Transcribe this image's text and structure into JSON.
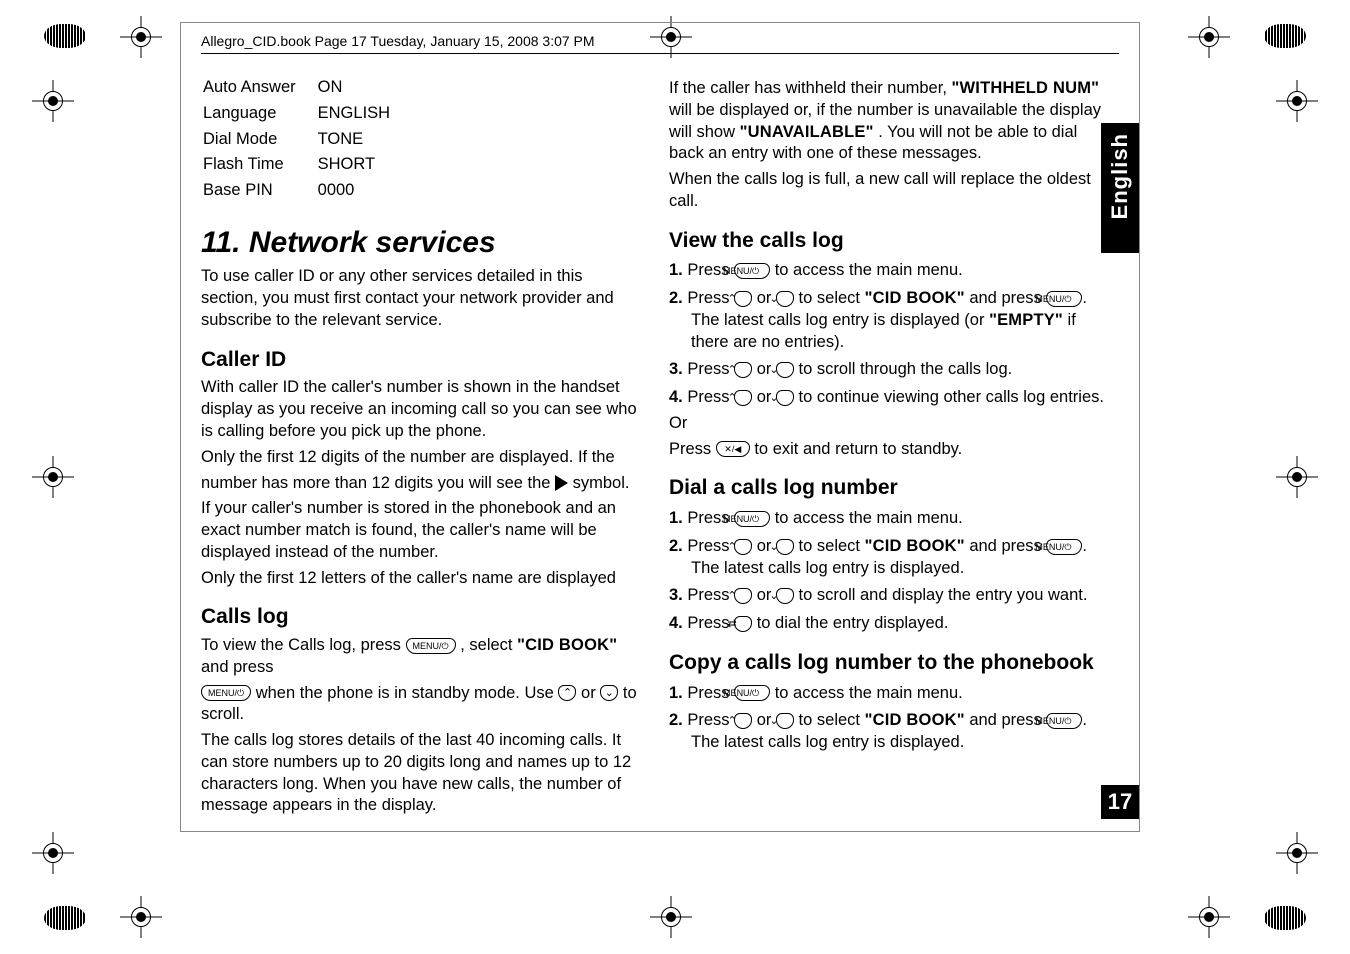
{
  "header_line": "Allegro_CID.book  Page 17  Tuesday, January 15, 2008  3:07 PM",
  "side_lang": "English",
  "page_number": "17",
  "settings": {
    "rows": [
      {
        "label": "Auto Answer",
        "value": "ON"
      },
      {
        "label": "Language",
        "value": "ENGLISH"
      },
      {
        "label": "Dial Mode",
        "value": "TONE"
      },
      {
        "label": "Flash Time",
        "value": "SHORT"
      },
      {
        "label": "Base PIN",
        "value": "0000"
      }
    ]
  },
  "left": {
    "h1": "11. Network services",
    "intro": "To use caller ID or any other services detailed in this section, you must first contact your network provider and subscribe to the relevant service.",
    "caller_id_h": "Caller ID",
    "caller_id_p1": "With caller ID the caller's number is shown in the handset display as you receive an incoming call so you can see who is calling before you pick up the phone.",
    "caller_id_p2": "Only the first 12 digits of the number are displayed. If the",
    "caller_id_p2b_a": "number has more than 12 digits you will see the ",
    "caller_id_p2b_b": " symbol.",
    "caller_id_p3": "If your caller's number is stored in the phonebook and an exact number match is found, the caller's name will be displayed instead of the number.",
    "caller_id_p4": "Only the first 12 letters of the caller's name are displayed",
    "calls_log_h": "Calls log",
    "calls_log_p1_a": "To view the Calls log, press ",
    "calls_log_p1_b": ", select ",
    "calls_log_p1_c": " and press",
    "calls_log_p2_a": "when the phone is in standby mode. Use ",
    "calls_log_p2_b": " or ",
    "calls_log_p2_c": " to scroll.",
    "calls_log_p3": "The calls log stores details of the last 40 incoming calls. It can store numbers up to 20 digits long and names up to 12 characters long. When you have new calls, the number of message appears in the display."
  },
  "right": {
    "top_p1_a": "If the caller has withheld their number, ",
    "top_p1_b": " will be displayed or, if the number is unavailable the display will show ",
    "top_p1_c": ". You will not be able to dial back an entry with one of these messages.",
    "top_p2": "When the calls log is full, a new call will replace the oldest call.",
    "view_h": "View the calls log",
    "view_s1_a": "Press ",
    "view_s1_b": " to access the main menu.",
    "view_s2_a": "Press ",
    "view_s2_b": " or ",
    "view_s2_c": " to select ",
    "view_s2_d": " and press ",
    "view_s2_e": ". The latest calls log entry is displayed (or ",
    "view_s2_f": " if there are no entries).",
    "view_s3_a": "Press ",
    "view_s3_b": " or ",
    "view_s3_c": " to scroll through the calls log.",
    "view_s4_a": "Press ",
    "view_s4_b": " or ",
    "view_s4_c": " to continue viewing other calls log entries.",
    "or": "Or",
    "view_exit_a": "Press ",
    "view_exit_b": " to exit and return to standby.",
    "dial_h": "Dial a calls log number",
    "dial_s1_a": "Press ",
    "dial_s1_b": " to access the main menu.",
    "dial_s2_a": "Press ",
    "dial_s2_b": " or ",
    "dial_s2_c": " to select ",
    "dial_s2_d": " and press ",
    "dial_s2_e": ". The latest calls log entry is displayed.",
    "dial_s3_a": "Press ",
    "dial_s3_b": " or ",
    "dial_s3_c": " to scroll and display the entry you want.",
    "dial_s4_a": "Press ",
    "dial_s4_b": " to dial the entry displayed.",
    "copy_h": "Copy a calls log number to the phonebook",
    "copy_s1_a": "Press ",
    "copy_s1_b": " to access the main menu.",
    "copy_s2_a": "Press ",
    "copy_s2_b": " or ",
    "copy_s2_c": " to select ",
    "copy_s2_d": " and press ",
    "copy_s2_e": ". The latest calls log entry is displayed."
  },
  "tokens": {
    "cid_book": "\"CID BOOK\"",
    "withheld": "\"WITHHELD NUM\"",
    "unavailable": "\"UNAVAILABLE\"",
    "empty": "\"EMPTY\"",
    "menu_btn": "MENU/⏻",
    "up_btn": "⌃",
    "down_btn": "⌄",
    "exit_btn": "✕/◀",
    "call_btn": "⇄"
  },
  "nums": {
    "n1": "1.",
    "n2": "2.",
    "n3": "3.",
    "n4": "4."
  }
}
